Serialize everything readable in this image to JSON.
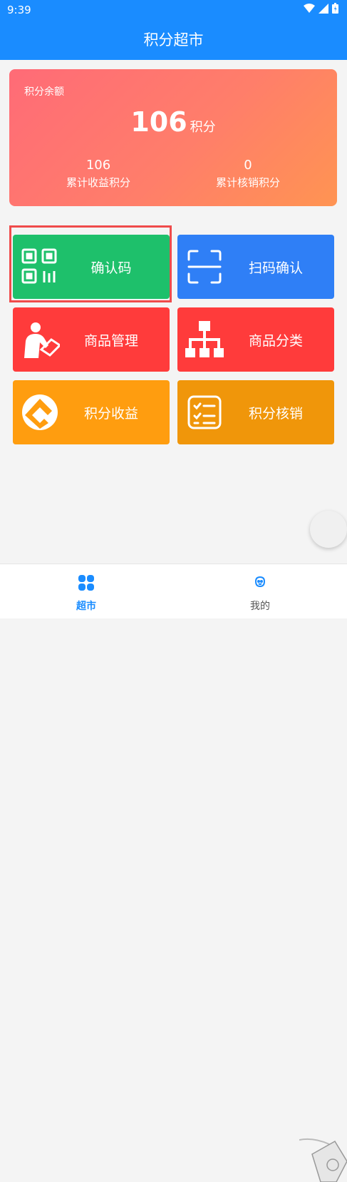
{
  "status": {
    "time": "9:39"
  },
  "header": {
    "title": "积分超市"
  },
  "balance": {
    "label": "积分余额",
    "value": "106",
    "unit": "积分",
    "earned": {
      "value": "106",
      "label": "累计收益积分"
    },
    "redeemed": {
      "value": "0",
      "label": "累计核销积分"
    }
  },
  "tiles": [
    {
      "label": "确认码",
      "icon": "qr-code-icon",
      "color": "#1ec06b"
    },
    {
      "label": "扫码确认",
      "icon": "scan-icon",
      "color": "#2f7ff6"
    },
    {
      "label": "商品管理",
      "icon": "person-reading-icon",
      "color": "#ff3b3b"
    },
    {
      "label": "商品分类",
      "icon": "hierarchy-icon",
      "color": "#ff3b3b"
    },
    {
      "label": "积分收益",
      "icon": "coin-logo-icon",
      "color": "#ff9d0f"
    },
    {
      "label": "积分核销",
      "icon": "checklist-icon",
      "color": "#f0960a"
    }
  ],
  "nav": [
    {
      "label": "超市",
      "icon": "grid-icon",
      "active": true
    },
    {
      "label": "我的",
      "icon": "face-icon",
      "active": false
    }
  ]
}
